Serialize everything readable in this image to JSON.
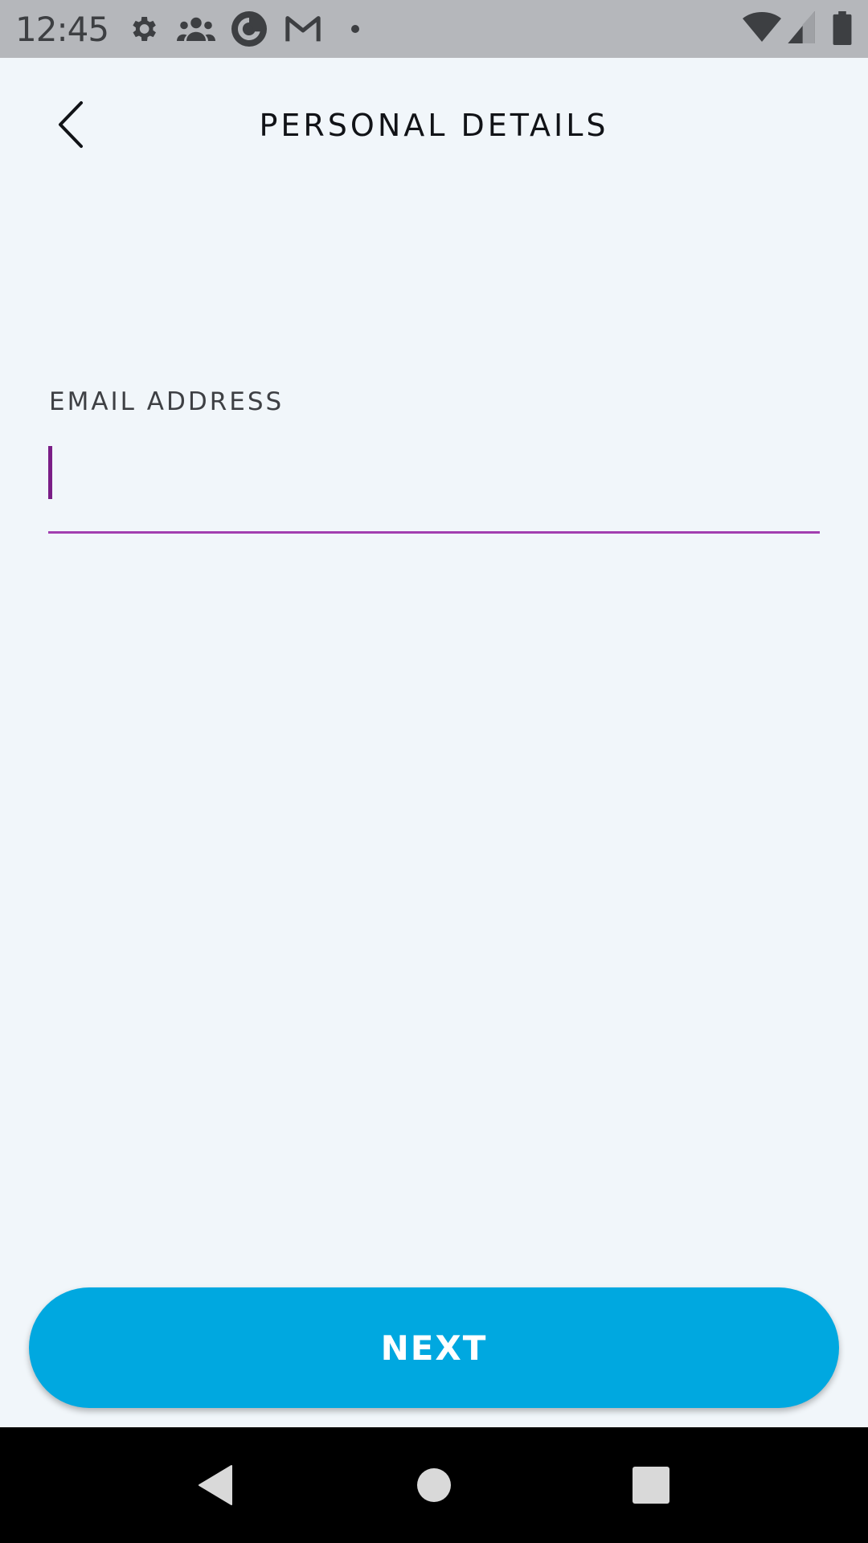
{
  "status_bar": {
    "time": "12:45",
    "left_icons": [
      "gear-icon",
      "people-group-icon",
      "app-circle-icon",
      "gmail-icon",
      "notification-dot-icon"
    ],
    "right_icons": [
      "wifi-icon",
      "cell-signal-icon",
      "battery-icon"
    ]
  },
  "header": {
    "title": "PERSONAL DETAILS",
    "back_icon": "chevron-left-icon"
  },
  "form": {
    "email_label": "EMAIL ADDRESS",
    "email_value": "",
    "accent_color": "#a23fb0"
  },
  "actions": {
    "next_label": "NEXT",
    "next_color": "#00a8e0"
  },
  "nav_bar": {
    "icons": [
      "back-triangle-icon",
      "home-circle-icon",
      "recents-square-icon"
    ]
  }
}
